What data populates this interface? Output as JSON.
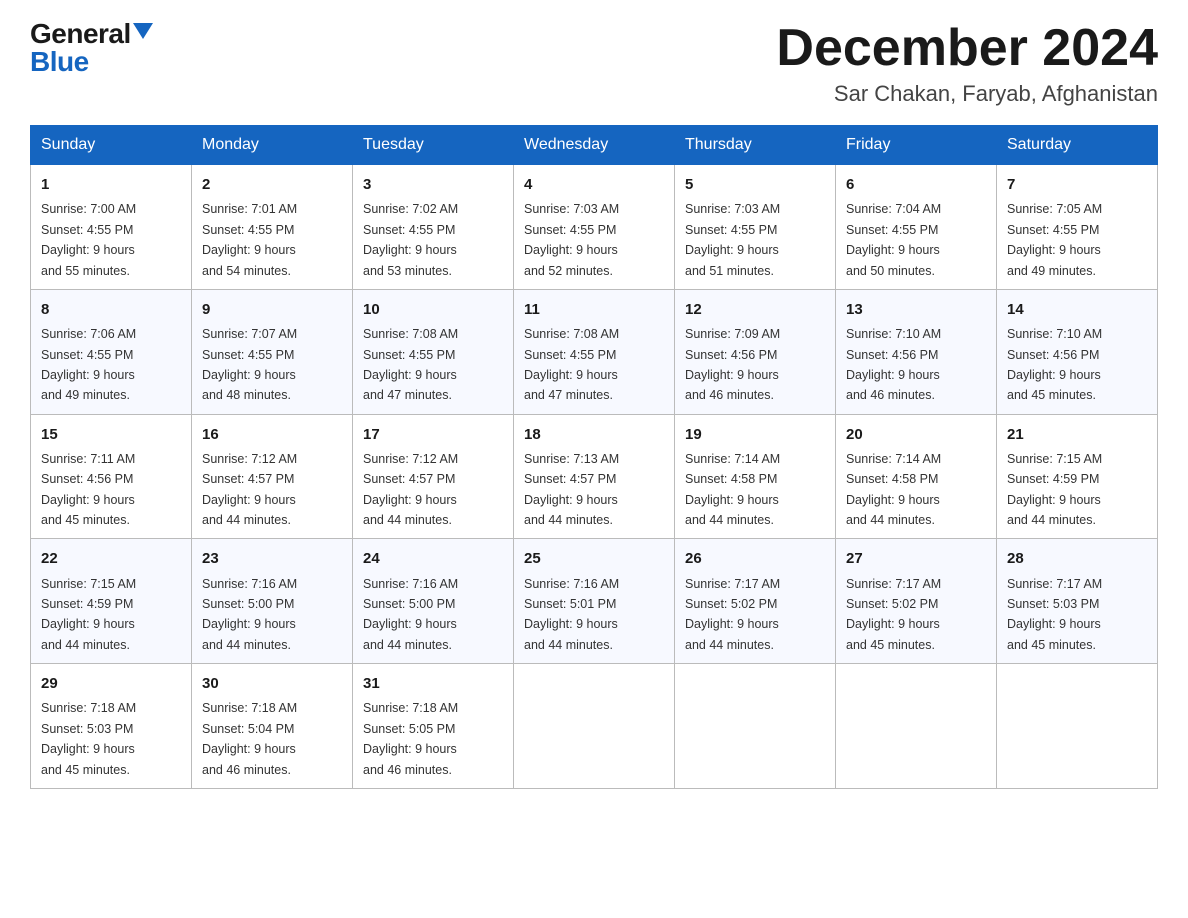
{
  "logo": {
    "general": "General",
    "blue": "Blue"
  },
  "title": {
    "month_year": "December 2024",
    "location": "Sar Chakan, Faryab, Afghanistan"
  },
  "days_of_week": [
    "Sunday",
    "Monday",
    "Tuesday",
    "Wednesday",
    "Thursday",
    "Friday",
    "Saturday"
  ],
  "weeks": [
    [
      {
        "day": "1",
        "sunrise": "7:00 AM",
        "sunset": "4:55 PM",
        "daylight": "9 hours and 55 minutes."
      },
      {
        "day": "2",
        "sunrise": "7:01 AM",
        "sunset": "4:55 PM",
        "daylight": "9 hours and 54 minutes."
      },
      {
        "day": "3",
        "sunrise": "7:02 AM",
        "sunset": "4:55 PM",
        "daylight": "9 hours and 53 minutes."
      },
      {
        "day": "4",
        "sunrise": "7:03 AM",
        "sunset": "4:55 PM",
        "daylight": "9 hours and 52 minutes."
      },
      {
        "day": "5",
        "sunrise": "7:03 AM",
        "sunset": "4:55 PM",
        "daylight": "9 hours and 51 minutes."
      },
      {
        "day": "6",
        "sunrise": "7:04 AM",
        "sunset": "4:55 PM",
        "daylight": "9 hours and 50 minutes."
      },
      {
        "day": "7",
        "sunrise": "7:05 AM",
        "sunset": "4:55 PM",
        "daylight": "9 hours and 49 minutes."
      }
    ],
    [
      {
        "day": "8",
        "sunrise": "7:06 AM",
        "sunset": "4:55 PM",
        "daylight": "9 hours and 49 minutes."
      },
      {
        "day": "9",
        "sunrise": "7:07 AM",
        "sunset": "4:55 PM",
        "daylight": "9 hours and 48 minutes."
      },
      {
        "day": "10",
        "sunrise": "7:08 AM",
        "sunset": "4:55 PM",
        "daylight": "9 hours and 47 minutes."
      },
      {
        "day": "11",
        "sunrise": "7:08 AM",
        "sunset": "4:55 PM",
        "daylight": "9 hours and 47 minutes."
      },
      {
        "day": "12",
        "sunrise": "7:09 AM",
        "sunset": "4:56 PM",
        "daylight": "9 hours and 46 minutes."
      },
      {
        "day": "13",
        "sunrise": "7:10 AM",
        "sunset": "4:56 PM",
        "daylight": "9 hours and 46 minutes."
      },
      {
        "day": "14",
        "sunrise": "7:10 AM",
        "sunset": "4:56 PM",
        "daylight": "9 hours and 45 minutes."
      }
    ],
    [
      {
        "day": "15",
        "sunrise": "7:11 AM",
        "sunset": "4:56 PM",
        "daylight": "9 hours and 45 minutes."
      },
      {
        "day": "16",
        "sunrise": "7:12 AM",
        "sunset": "4:57 PM",
        "daylight": "9 hours and 44 minutes."
      },
      {
        "day": "17",
        "sunrise": "7:12 AM",
        "sunset": "4:57 PM",
        "daylight": "9 hours and 44 minutes."
      },
      {
        "day": "18",
        "sunrise": "7:13 AM",
        "sunset": "4:57 PM",
        "daylight": "9 hours and 44 minutes."
      },
      {
        "day": "19",
        "sunrise": "7:14 AM",
        "sunset": "4:58 PM",
        "daylight": "9 hours and 44 minutes."
      },
      {
        "day": "20",
        "sunrise": "7:14 AM",
        "sunset": "4:58 PM",
        "daylight": "9 hours and 44 minutes."
      },
      {
        "day": "21",
        "sunrise": "7:15 AM",
        "sunset": "4:59 PM",
        "daylight": "9 hours and 44 minutes."
      }
    ],
    [
      {
        "day": "22",
        "sunrise": "7:15 AM",
        "sunset": "4:59 PM",
        "daylight": "9 hours and 44 minutes."
      },
      {
        "day": "23",
        "sunrise": "7:16 AM",
        "sunset": "5:00 PM",
        "daylight": "9 hours and 44 minutes."
      },
      {
        "day": "24",
        "sunrise": "7:16 AM",
        "sunset": "5:00 PM",
        "daylight": "9 hours and 44 minutes."
      },
      {
        "day": "25",
        "sunrise": "7:16 AM",
        "sunset": "5:01 PM",
        "daylight": "9 hours and 44 minutes."
      },
      {
        "day": "26",
        "sunrise": "7:17 AM",
        "sunset": "5:02 PM",
        "daylight": "9 hours and 44 minutes."
      },
      {
        "day": "27",
        "sunrise": "7:17 AM",
        "sunset": "5:02 PM",
        "daylight": "9 hours and 45 minutes."
      },
      {
        "day": "28",
        "sunrise": "7:17 AM",
        "sunset": "5:03 PM",
        "daylight": "9 hours and 45 minutes."
      }
    ],
    [
      {
        "day": "29",
        "sunrise": "7:18 AM",
        "sunset": "5:03 PM",
        "daylight": "9 hours and 45 minutes."
      },
      {
        "day": "30",
        "sunrise": "7:18 AM",
        "sunset": "5:04 PM",
        "daylight": "9 hours and 46 minutes."
      },
      {
        "day": "31",
        "sunrise": "7:18 AM",
        "sunset": "5:05 PM",
        "daylight": "9 hours and 46 minutes."
      },
      null,
      null,
      null,
      null
    ]
  ],
  "labels": {
    "sunrise": "Sunrise:",
    "sunset": "Sunset:",
    "daylight": "Daylight:"
  }
}
